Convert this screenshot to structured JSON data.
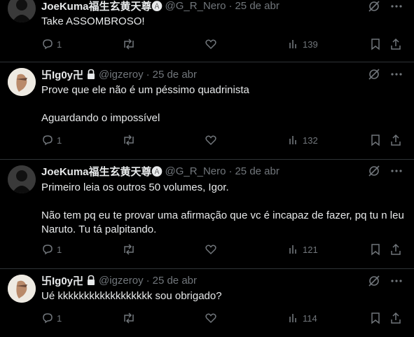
{
  "tweets": [
    {
      "name": "JoeKuma福生玄黄天尊🅐",
      "handle": "@G_R_Nero",
      "time": "25 de abr",
      "text": "Take ASSOMBROSO!",
      "replies": "1",
      "views": "139"
    },
    {
      "name": "卐Ig0y卍",
      "handle": "@igzeroy",
      "time": "25 de abr",
      "text": "Prove que ele não é um péssimo quadrinista\n\nAguardando o impossível",
      "replies": "1",
      "views": "132"
    },
    {
      "name": "JoeKuma福生玄黄天尊🅐",
      "handle": "@G_R_Nero",
      "time": "25 de abr",
      "text": "Primeiro leia os outros 50 volumes, Igor.\n\nNão tem pq eu te provar uma afirmação que vc é incapaz de fazer, pq tu n leu Naruto. Tu tá palpitando.",
      "replies": "1",
      "views": "121"
    },
    {
      "name": "卐Ig0y卍",
      "handle": "@igzeroy",
      "time": "25 de abr",
      "text": "Ué kkkkkkkkkkkkkkkkkk sou obrigado?",
      "replies": "1",
      "views": "114"
    }
  ],
  "separator": "·",
  "colors": {
    "background": "#000000",
    "text": "#e7e9ea",
    "muted": "#71767b",
    "border": "#2f3336"
  }
}
